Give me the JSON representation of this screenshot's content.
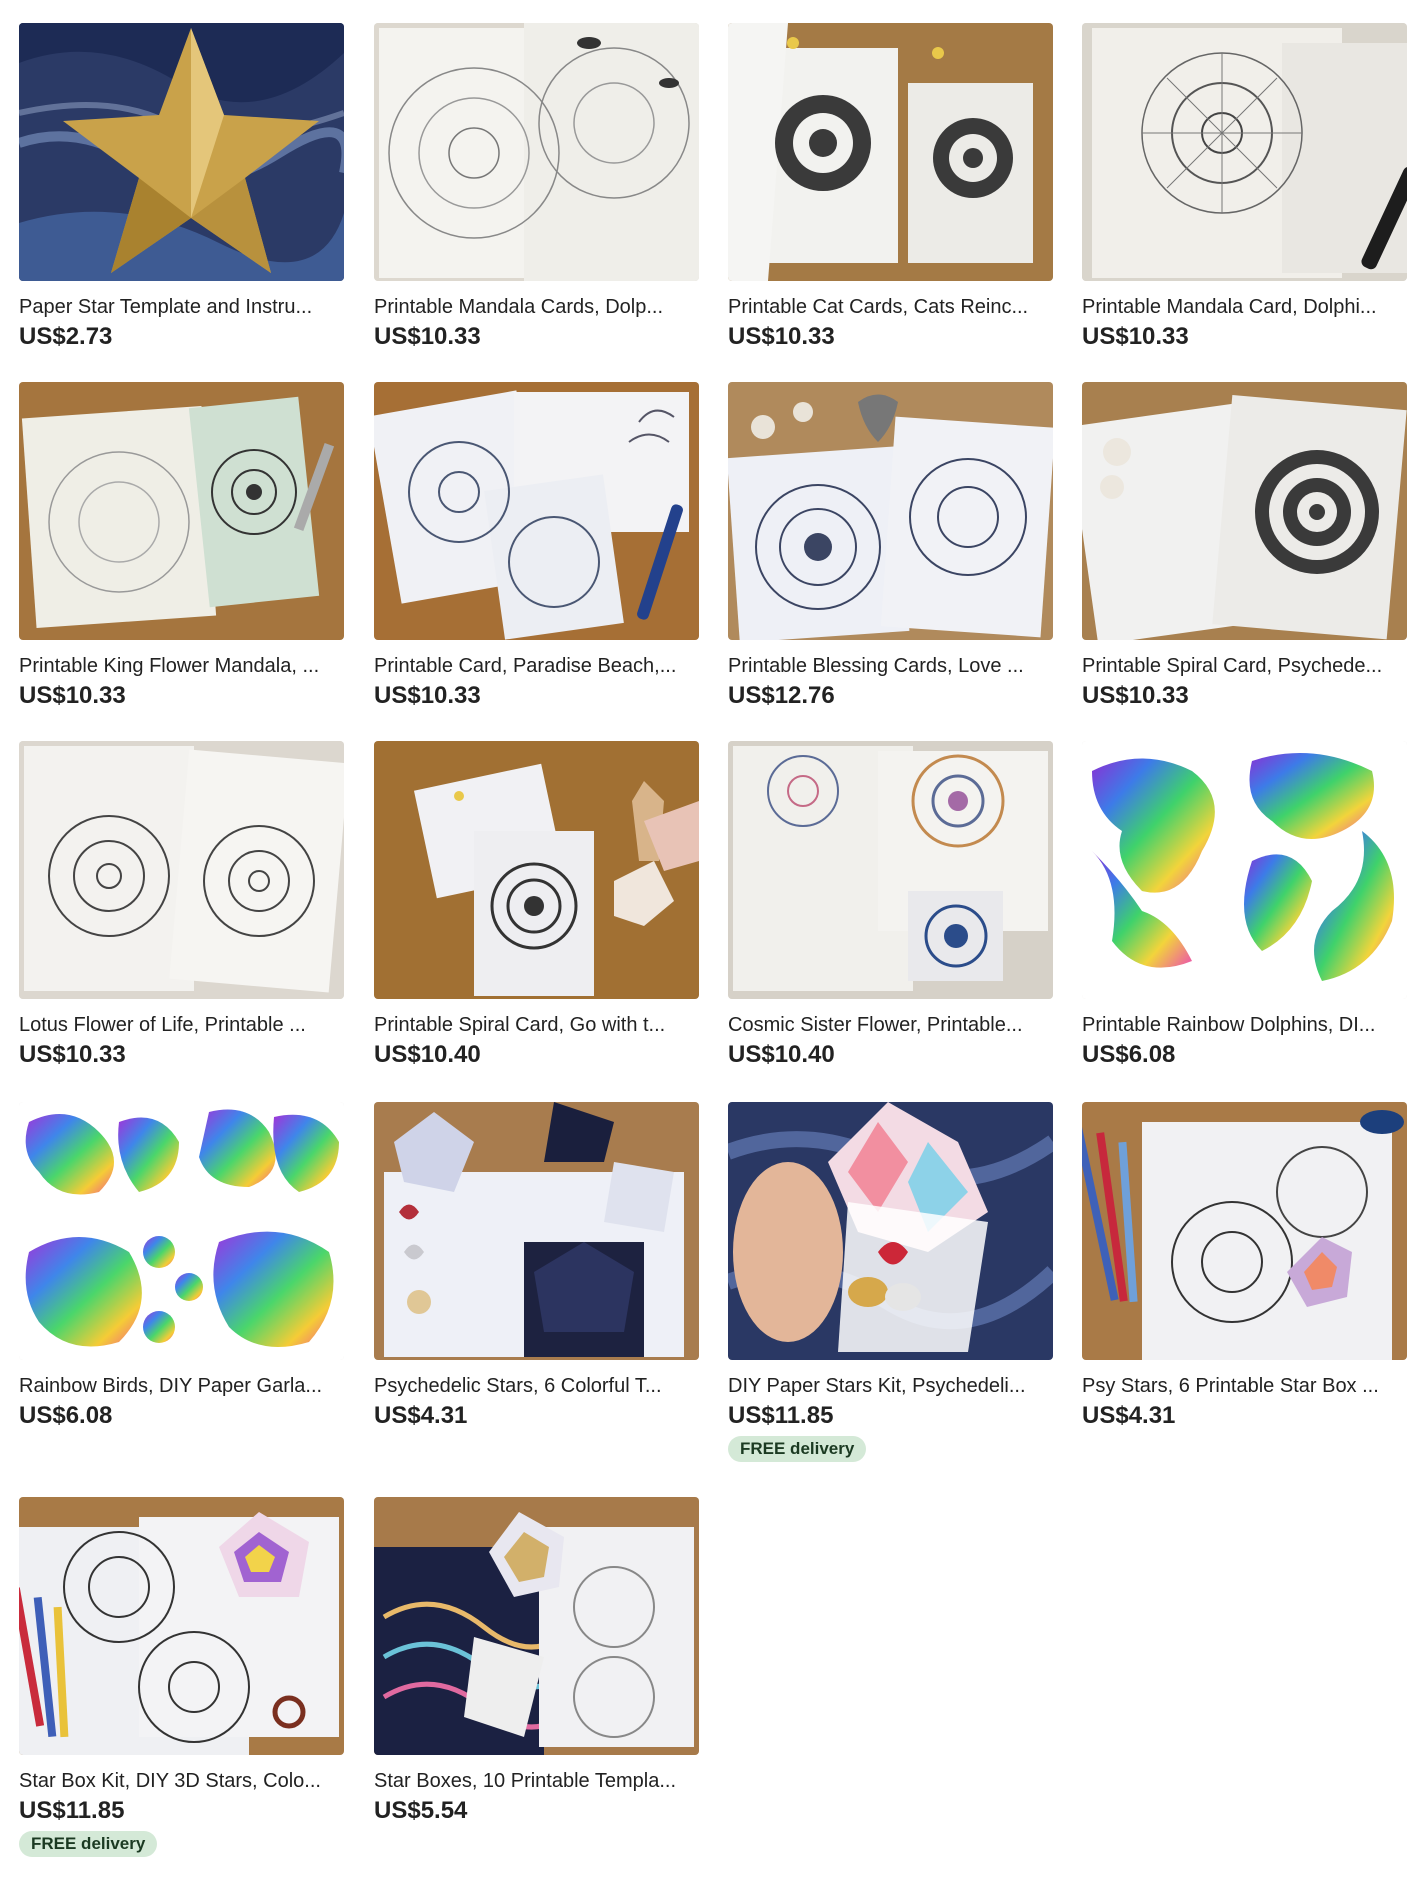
{
  "listings": [
    {
      "title": "Paper Star Template and Instru...",
      "price": "US$2.73",
      "image": "gold-paper-star-on-blue-cloth"
    },
    {
      "title": "Printable Mandala Cards, Dolp...",
      "price": "US$10.33",
      "image": "dolphin-mandala-cards"
    },
    {
      "title": "Printable Cat Cards, Cats Reinc...",
      "price": "US$10.33",
      "image": "cat-mandala-cards-on-wood"
    },
    {
      "title": "Printable Mandala Card, Dolphi...",
      "price": "US$10.33",
      "image": "dolphin-mandala-card-with-pen"
    },
    {
      "title": "Printable King Flower Mandala, ...",
      "price": "US$10.33",
      "image": "king-flower-mandala-green-card"
    },
    {
      "title": "Printable Card, Paradise Beach,...",
      "price": "US$10.33",
      "image": "paradise-beach-cards-blue-pen"
    },
    {
      "title": "Printable Blessing Cards, Love ...",
      "price": "US$12.76",
      "image": "blessing-heart-mandala-cards"
    },
    {
      "title": "Printable Spiral Card, Psychede...",
      "price": "US$10.33",
      "image": "spiral-mandala-card-envelope"
    },
    {
      "title": "Lotus Flower of Life, Printable ...",
      "price": "US$10.33",
      "image": "lotus-flower-of-life-cards"
    },
    {
      "title": "Printable Spiral Card, Go with t...",
      "price": "US$10.40",
      "image": "spiral-card-with-crystals"
    },
    {
      "title": "Cosmic Sister Flower, Printable...",
      "price": "US$10.40",
      "image": "cosmic-sister-flower-cards"
    },
    {
      "title": "Printable Rainbow Dolphins, DI...",
      "price": "US$6.08",
      "image": "rainbow-dolphin-cutouts"
    },
    {
      "title": "Rainbow Birds, DIY Paper Garla...",
      "price": "US$6.08",
      "image": "rainbow-bird-cutouts"
    },
    {
      "title": "Psychedelic Stars, 6 Colorful T...",
      "price": "US$4.31",
      "image": "psychedelic-paper-stars"
    },
    {
      "title": "DIY Paper Stars Kit, Psychedeli...",
      "price": "US$11.85",
      "badge": "FREE delivery",
      "image": "star-box-in-hand-with-chocolates"
    },
    {
      "title": "Psy Stars, 6 Printable Star Box ...",
      "price": "US$4.31",
      "image": "psy-star-box-with-pens"
    },
    {
      "title": "Star Box Kit, DIY 3D Stars, Colo...",
      "price": "US$11.85",
      "badge": "FREE delivery",
      "image": "star-box-kit-with-scissors"
    },
    {
      "title": "Star Boxes, 10 Printable Templa...",
      "price": "US$5.54",
      "image": "star-boxes-printable-templates"
    }
  ]
}
